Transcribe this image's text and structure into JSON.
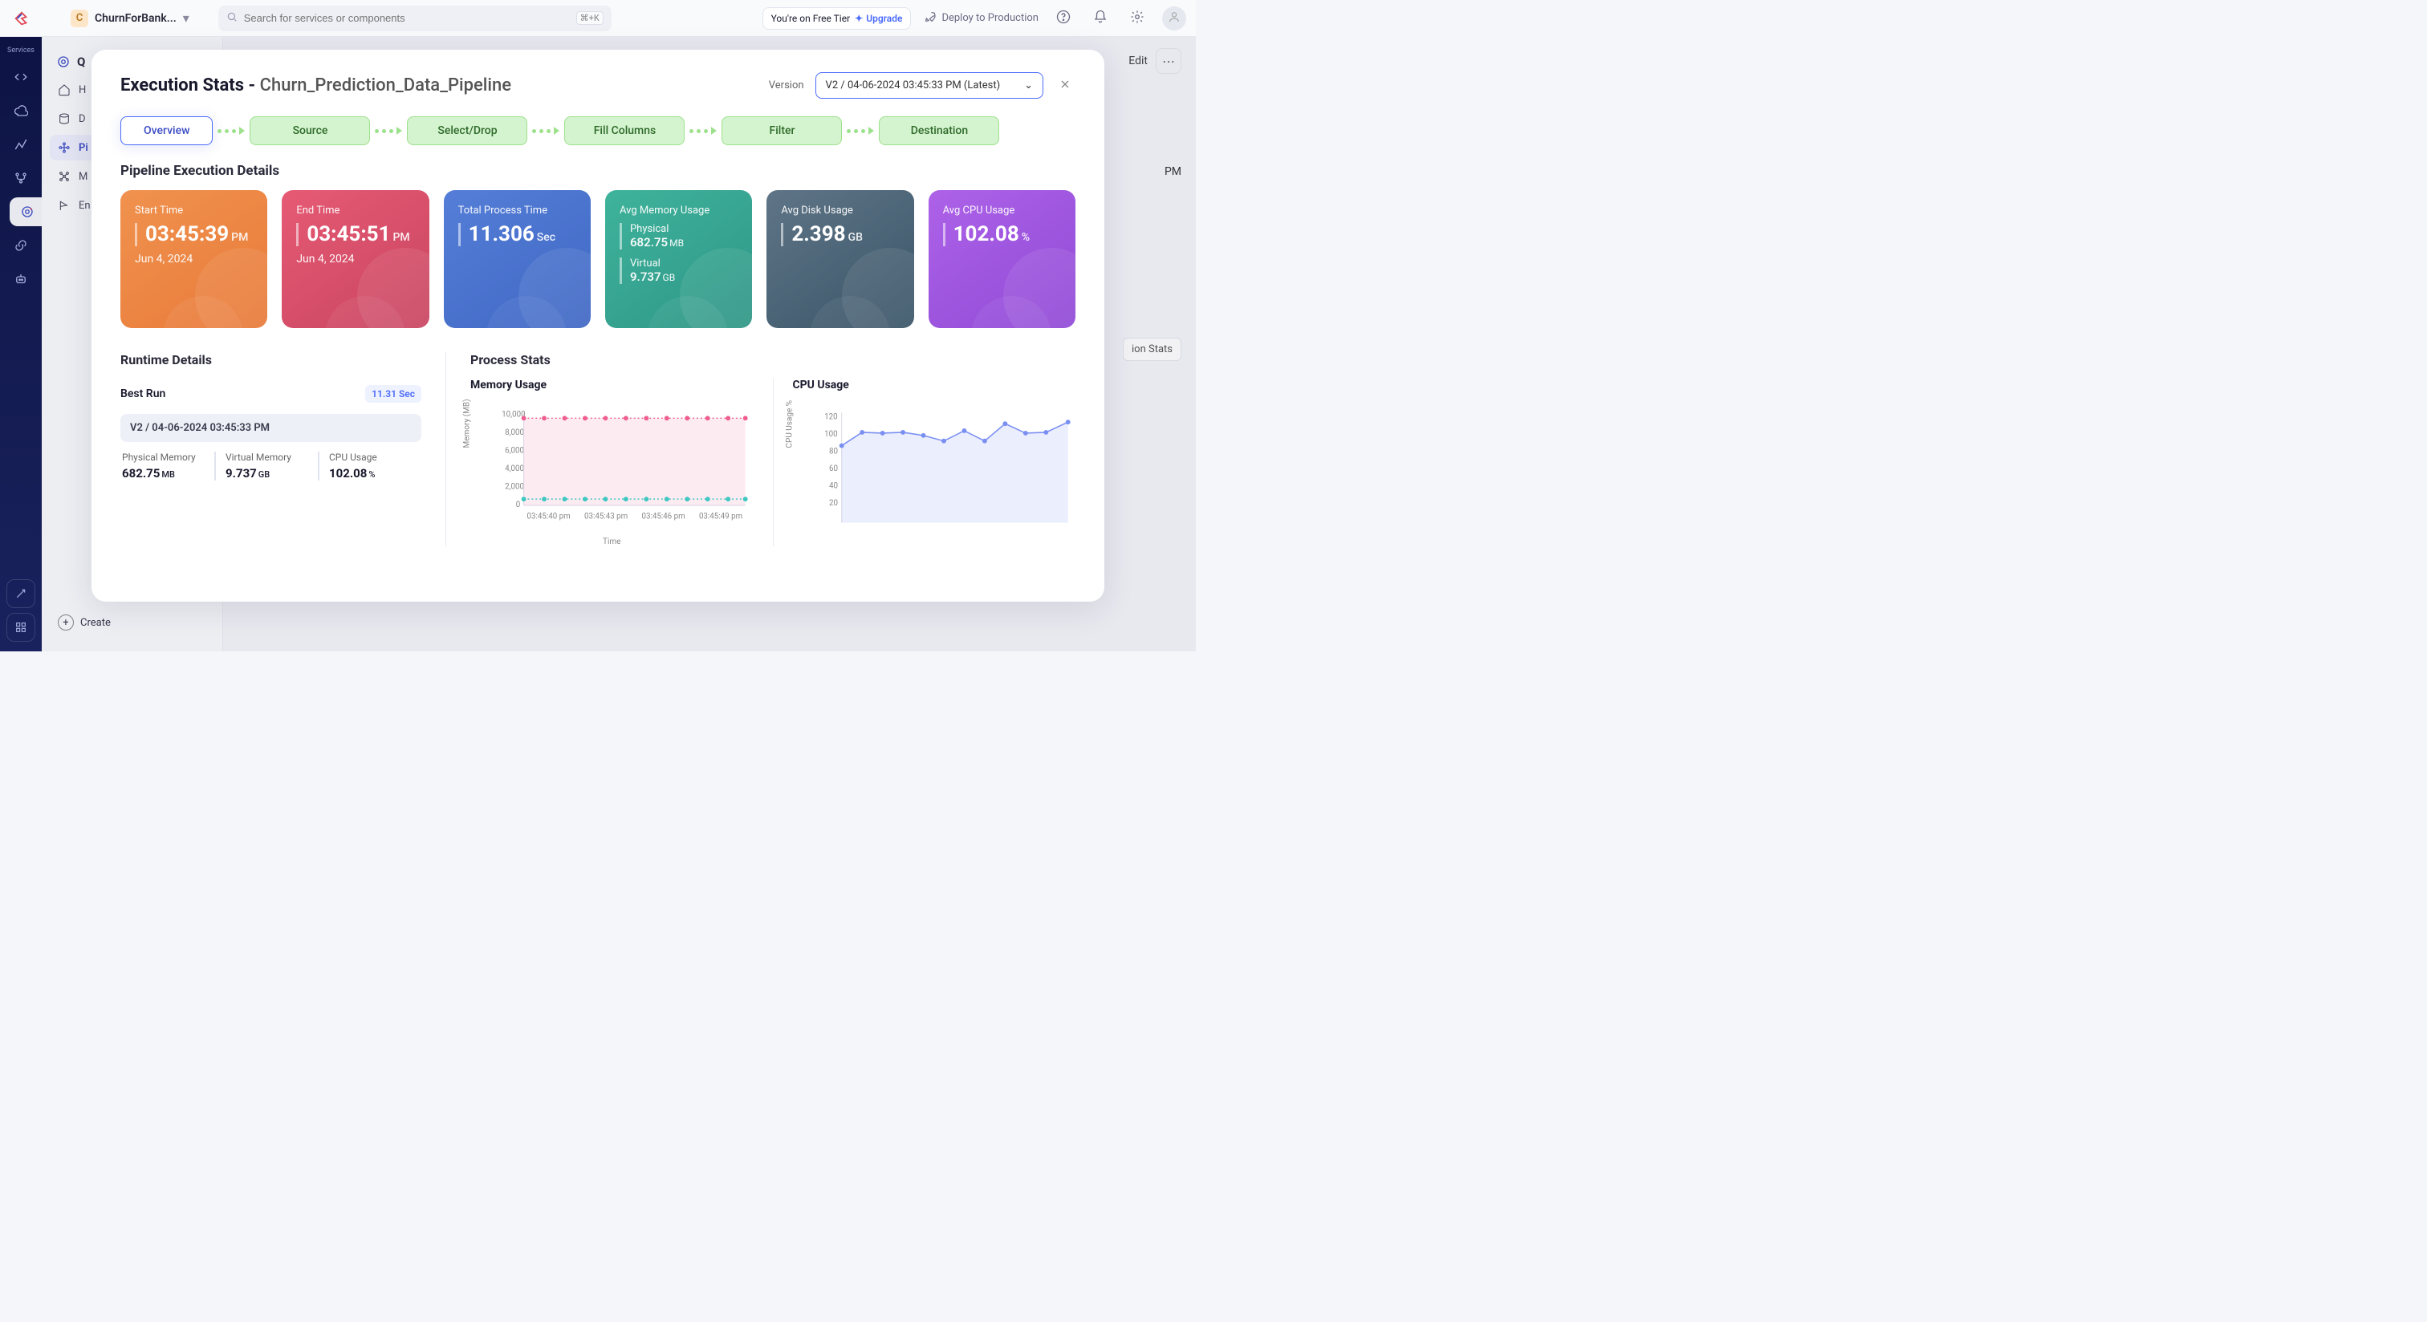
{
  "topbar": {
    "org_initial": "C",
    "org_name": "ChurnForBank...",
    "search_placeholder": "Search for services or components",
    "search_kbd": "⌘+K",
    "tier_text": "You're on Free Tier",
    "upgrade_label": "Upgrade",
    "deploy_label": "Deploy to Production"
  },
  "rail": {
    "section": "Services",
    "title": "Q",
    "items": [
      {
        "label": "H",
        "icon": "home"
      },
      {
        "label": "D",
        "icon": "database"
      },
      {
        "label": "Pi",
        "icon": "pipeline",
        "active": true
      },
      {
        "label": "M",
        "icon": "model"
      },
      {
        "label": "En",
        "icon": "flag"
      }
    ],
    "create_label": "Create"
  },
  "bg": {
    "edit": "Edit",
    "time_right": "PM",
    "exec_stats": "ion Stats"
  },
  "modal": {
    "title_prefix": "Execution Stats - ",
    "title_name": "Churn_Prediction_Data_Pipeline",
    "version_label": "Version",
    "version_value": "V2 / 04-06-2024 03:45:33 PM (Latest)",
    "stages": {
      "overview": "Overview",
      "source": "Source",
      "select": "Select/Drop",
      "fill": "Fill Columns",
      "filter": "Filter",
      "dest": "Destination"
    },
    "pipeline_section": "Pipeline Execution Details",
    "cards": {
      "start": {
        "label": "Start Time",
        "value": "03:45:39",
        "unit": "PM",
        "date": "Jun 4, 2024"
      },
      "end": {
        "label": "End Time",
        "value": "03:45:51",
        "unit": "PM",
        "date": "Jun 4, 2024"
      },
      "process": {
        "label": "Total Process Time",
        "value": "11.306",
        "unit": "Sec"
      },
      "mem": {
        "label": "Avg Memory Usage",
        "phys_label": "Physical",
        "phys_val": "682.75",
        "phys_unit": "MB",
        "virt_label": "Virtual",
        "virt_val": "9.737",
        "virt_unit": "GB"
      },
      "disk": {
        "label": "Avg Disk Usage",
        "value": "2.398",
        "unit": "GB"
      },
      "cpu": {
        "label": "Avg CPU Usage",
        "value": "102.08",
        "unit": "%"
      }
    },
    "runtime": {
      "title": "Runtime Details",
      "best_label": "Best Run",
      "best_val": "11.31 Sec",
      "version_band": "V2 / 04-06-2024 03:45:33 PM",
      "metrics": [
        {
          "label": "Physical Memory",
          "value": "682.75",
          "unit": "MB"
        },
        {
          "label": "Virtual Memory",
          "value": "9.737",
          "unit": "GB"
        },
        {
          "label": "CPU Usage",
          "value": "102.08",
          "unit": "%"
        }
      ]
    },
    "process": {
      "title": "Process Stats",
      "mem_title": "Memory Usage",
      "cpu_title": "CPU Usage",
      "mem_ylabel": "Memory (MB)",
      "cpu_ylabel": "CPU Usage %",
      "xlabel": "Time"
    }
  },
  "chart_data": [
    {
      "type": "line",
      "title": "Memory Usage",
      "ylabel": "Memory (MB)",
      "xlabel": "Time",
      "ylim": [
        0,
        10000
      ],
      "yticks": [
        0,
        2000,
        4000,
        6000,
        8000,
        10000
      ],
      "xticks": [
        "03:45:40 pm",
        "03:45:43 pm",
        "03:45:46 pm",
        "03:45:49 pm"
      ],
      "categories": [
        "03:45:40",
        "03:45:41",
        "03:45:42",
        "03:45:43",
        "03:45:44",
        "03:45:45",
        "03:45:46",
        "03:45:47",
        "03:45:48",
        "03:45:49",
        "03:45:50",
        "03:45:51"
      ],
      "series": [
        {
          "name": "Virtual",
          "color": "#ef5e90",
          "values": [
            9737,
            9737,
            9737,
            9737,
            9737,
            9737,
            9737,
            9737,
            9737,
            9737,
            9737,
            9737
          ]
        },
        {
          "name": "Physical",
          "color": "#3fc7c1",
          "values": [
            683,
            683,
            683,
            683,
            683,
            683,
            683,
            683,
            683,
            683,
            683,
            683
          ]
        }
      ]
    },
    {
      "type": "line",
      "title": "CPU Usage",
      "ylabel": "CPU Usage %",
      "xlabel": "Time",
      "ylim": [
        0,
        130
      ],
      "yticks": [
        20,
        40,
        60,
        80,
        100,
        120
      ],
      "categories": [
        "03:45:40",
        "03:45:41",
        "03:45:42",
        "03:45:43",
        "03:45:44",
        "03:45:45",
        "03:45:46",
        "03:45:47",
        "03:45:48",
        "03:45:49",
        "03:45:50",
        "03:45:51"
      ],
      "series": [
        {
          "name": "CPU",
          "color": "#7a8ff2",
          "values": [
            88,
            104,
            103,
            104,
            100,
            94,
            107,
            94,
            112,
            103,
            104,
            114
          ]
        }
      ]
    }
  ]
}
